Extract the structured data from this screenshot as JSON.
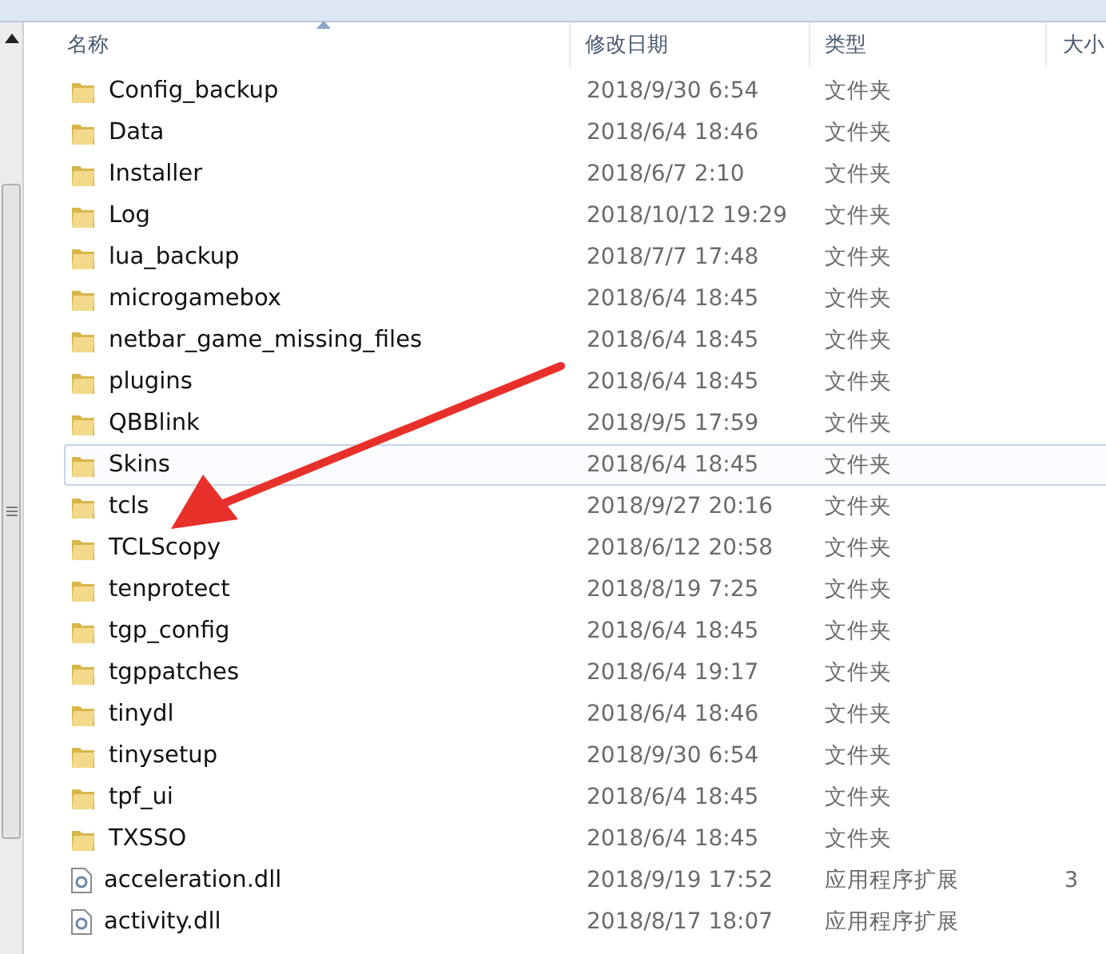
{
  "columns": [
    {
      "label": "名称",
      "sorted": true
    },
    {
      "label": "修改日期",
      "sorted": false
    },
    {
      "label": "类型",
      "sorted": false
    },
    {
      "label": "大小",
      "sorted": false
    }
  ],
  "rows": [
    {
      "kind": "folder",
      "name": "Config_backup",
      "date": "2018/9/30 6:54",
      "type": "文件夹",
      "selected": false
    },
    {
      "kind": "folder",
      "name": "Data",
      "date": "2018/6/4 18:46",
      "type": "文件夹",
      "selected": false
    },
    {
      "kind": "folder",
      "name": "Installer",
      "date": "2018/6/7 2:10",
      "type": "文件夹",
      "selected": false
    },
    {
      "kind": "folder",
      "name": "Log",
      "date": "2018/10/12 19:29",
      "type": "文件夹",
      "selected": false
    },
    {
      "kind": "folder",
      "name": "lua_backup",
      "date": "2018/7/7 17:48",
      "type": "文件夹",
      "selected": false
    },
    {
      "kind": "folder",
      "name": "microgamebox",
      "date": "2018/6/4 18:45",
      "type": "文件夹",
      "selected": false
    },
    {
      "kind": "folder",
      "name": "netbar_game_missing_files",
      "date": "2018/6/4 18:45",
      "type": "文件夹",
      "selected": false
    },
    {
      "kind": "folder",
      "name": "plugins",
      "date": "2018/6/4 18:45",
      "type": "文件夹",
      "selected": false
    },
    {
      "kind": "folder",
      "name": "QBBlink",
      "date": "2018/9/5 17:59",
      "type": "文件夹",
      "selected": false
    },
    {
      "kind": "folder",
      "name": "Skins",
      "date": "2018/6/4 18:45",
      "type": "文件夹",
      "selected": true
    },
    {
      "kind": "folder",
      "name": "tcls",
      "date": "2018/9/27 20:16",
      "type": "文件夹",
      "selected": false
    },
    {
      "kind": "folder",
      "name": "TCLScopy",
      "date": "2018/6/12 20:58",
      "type": "文件夹",
      "selected": false
    },
    {
      "kind": "folder",
      "name": "tenprotect",
      "date": "2018/8/19 7:25",
      "type": "文件夹",
      "selected": false
    },
    {
      "kind": "folder",
      "name": "tgp_config",
      "date": "2018/6/4 18:45",
      "type": "文件夹",
      "selected": false
    },
    {
      "kind": "folder",
      "name": "tgppatches",
      "date": "2018/6/4 19:17",
      "type": "文件夹",
      "selected": false
    },
    {
      "kind": "folder",
      "name": "tinydl",
      "date": "2018/6/4 18:46",
      "type": "文件夹",
      "selected": false
    },
    {
      "kind": "folder",
      "name": "tinysetup",
      "date": "2018/9/30 6:54",
      "type": "文件夹",
      "selected": false
    },
    {
      "kind": "folder",
      "name": "tpf_ui",
      "date": "2018/6/4 18:45",
      "type": "文件夹",
      "selected": false
    },
    {
      "kind": "folder",
      "name": "TXSSO",
      "date": "2018/6/4 18:45",
      "type": "文件夹",
      "selected": false
    },
    {
      "kind": "file",
      "name": "acceleration.dll",
      "date": "2018/9/19 17:52",
      "type": "应用程序扩展",
      "size": "3",
      "selected": false
    },
    {
      "kind": "file",
      "name": "activity.dll",
      "date": "2018/8/17 18:07",
      "type": "应用程序扩展",
      "selected": false
    }
  ]
}
